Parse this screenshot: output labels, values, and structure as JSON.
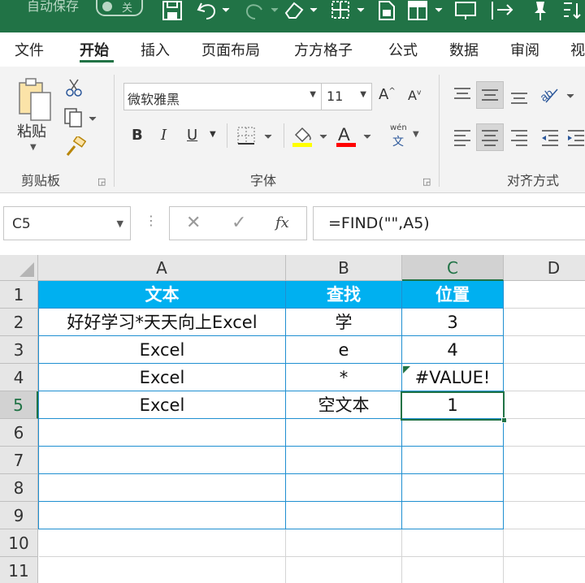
{
  "titlebar": {
    "autosave_label": "自动保存",
    "autosave_state": "关"
  },
  "tabs": [
    "文件",
    "开始",
    "插入",
    "页面布局",
    "方方格子",
    "公式",
    "数据",
    "审阅",
    "视"
  ],
  "ribbon": {
    "clipboard": {
      "paste_label": "粘贴",
      "group_label": "剪贴板"
    },
    "font": {
      "font_name": "微软雅黑",
      "font_size": "11",
      "bold": "B",
      "italic": "I",
      "underline": "U",
      "font_color_letter": "A",
      "phonetic_top": "wén",
      "phonetic_bottom": "文",
      "grow_label": "A",
      "shrink_label": "A",
      "group_label": "字体"
    },
    "alignment": {
      "group_label": "对齐方式"
    },
    "colors": {
      "accent": "#217346",
      "header_fill": "#00b0f0",
      "table_border": "#1f8fd1",
      "font_color_bar": "#ff0000",
      "fill_color_bar": "#ffff00"
    }
  },
  "formula_bar": {
    "name_box": "C5",
    "cancel": "✕",
    "enter": "✓",
    "fx": "fx",
    "formula": "=FIND(\"\",A5)"
  },
  "sheet": {
    "columns": [
      "A",
      "B",
      "C",
      "D"
    ],
    "selected_column": "C",
    "selected_row": "5",
    "rows": [
      "1",
      "2",
      "3",
      "4",
      "5",
      "6",
      "7",
      "8",
      "9",
      "10",
      "11"
    ],
    "cells": [
      [
        "文本",
        "查找",
        "位置"
      ],
      [
        "好好学习*天天向上Excel",
        "学",
        "3"
      ],
      [
        "Excel",
        "e",
        "4"
      ],
      [
        "Excel",
        "*",
        "#VALUE!"
      ],
      [
        "Excel",
        "空文本",
        "1"
      ]
    ]
  }
}
